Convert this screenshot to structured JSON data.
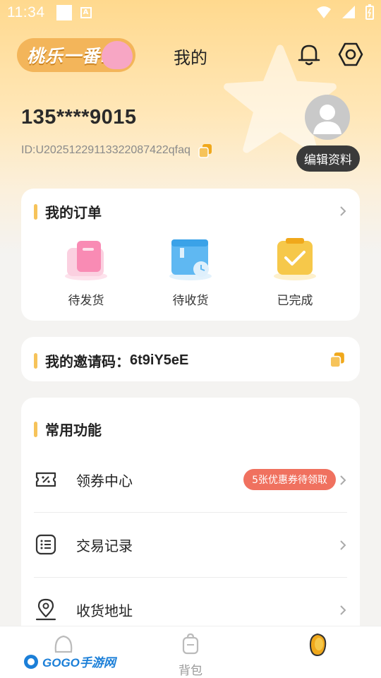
{
  "status_bar": {
    "time": "11:34"
  },
  "header": {
    "logo_text": "桃乐一番!",
    "title": "我的"
  },
  "profile": {
    "phone": "135****9015",
    "uid": "ID:U20251229113322087422qfaq",
    "edit_label": "编辑资料"
  },
  "orders": {
    "title": "我的订单",
    "items": [
      {
        "label": "待发货",
        "icon": "delivery-box-icon",
        "color": "#f98bb4"
      },
      {
        "label": "待收货",
        "icon": "receive-package-icon",
        "color": "#5fb8f2"
      },
      {
        "label": "已完成",
        "icon": "completed-check-icon",
        "color": "#f6c84a"
      }
    ]
  },
  "invite": {
    "label": "我的邀请码：",
    "code": "6t9iY5eE"
  },
  "functions": {
    "title": "常用功能",
    "items": [
      {
        "label": "领券中心",
        "icon": "coupon-icon",
        "badge": "5张优惠券待领取"
      },
      {
        "label": "交易记录",
        "icon": "list-icon"
      },
      {
        "label": "收货地址",
        "icon": "location-icon"
      }
    ]
  },
  "bottom_nav": {
    "items": [
      {
        "label": "",
        "icon": "home-icon"
      },
      {
        "label": "背包",
        "icon": "backpack-icon"
      },
      {
        "label": "",
        "icon": "profile-mascot-icon",
        "active": true
      }
    ]
  },
  "watermark": {
    "text": "GOGO手游网"
  },
  "colors": {
    "accent": "#f6c35a",
    "badge": "#f0715f",
    "header_gradient": "#ffd98e"
  }
}
